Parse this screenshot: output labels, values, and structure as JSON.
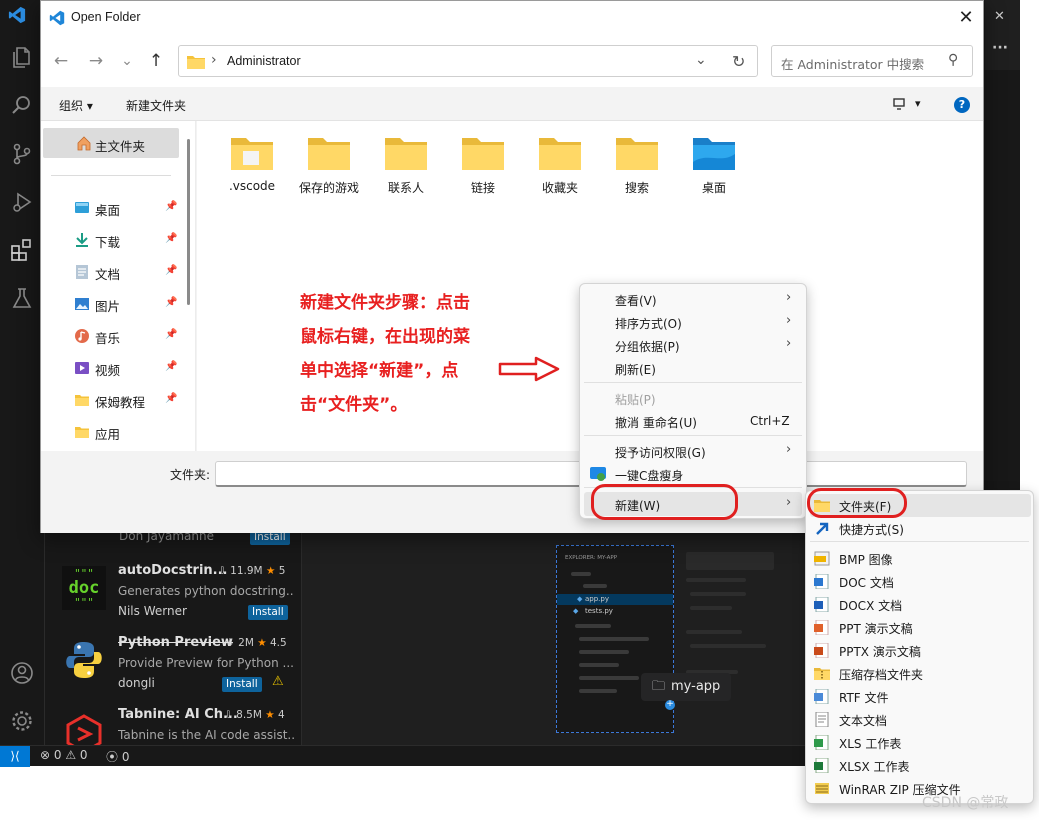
{
  "dialog": {
    "title": "Open Folder",
    "close_glyph": "✕",
    "nav": {
      "back": "←",
      "forward": "→",
      "recent": "⌄",
      "up": "↑"
    },
    "address": {
      "separator": "›",
      "current": "Administrator",
      "dropdown": "⌄",
      "refresh": "↻"
    },
    "search": {
      "placeholder": "在 Administrator 中搜索",
      "icon": "⚲"
    },
    "toolbar": {
      "organize": "组织 ▾",
      "new_folder": "新建文件夹",
      "view_glyph": "▾",
      "help": "?"
    },
    "sidebar": {
      "home": "主文件夹",
      "items": [
        {
          "label": "桌面",
          "icon": "desktop-icon",
          "pinned": true
        },
        {
          "label": "下载",
          "icon": "download-icon",
          "pinned": true
        },
        {
          "label": "文档",
          "icon": "document-icon",
          "pinned": true
        },
        {
          "label": "图片",
          "icon": "pictures-icon",
          "pinned": true
        },
        {
          "label": "音乐",
          "icon": "music-icon",
          "pinned": true
        },
        {
          "label": "视频",
          "icon": "video-icon",
          "pinned": true
        },
        {
          "label": "保姆教程",
          "icon": "folder-icon",
          "pinned": true
        },
        {
          "label": "应用",
          "icon": "folder-icon",
          "pinned": false
        }
      ],
      "pin_glyph": "📌"
    },
    "files": [
      ".vscode",
      "保存的游戏",
      "联系人",
      "链接",
      "收藏夹",
      "搜索",
      "桌面"
    ],
    "folder_field_label": "文件夹:"
  },
  "annotation": {
    "lines": [
      "新建文件夹步骤：点击",
      "鼠标右键，在出现的菜",
      "单中选择“新建”，点",
      "击“文件夹”。"
    ],
    "color": "#e82020"
  },
  "context_menu": {
    "items": [
      {
        "label": "查看(V)",
        "arrow": "›"
      },
      {
        "label": "排序方式(O)",
        "arrow": "›"
      },
      {
        "label": "分组依据(P)",
        "arrow": "›"
      },
      {
        "label": "刷新(E)"
      },
      {
        "label": "粘贴(P)",
        "disabled": true
      },
      {
        "label": "撤消 重命名(U)",
        "shortcut": "Ctrl+Z"
      },
      {
        "label": "授予访问权限(G)",
        "arrow": "›"
      },
      {
        "label": "一键C盘瘦身"
      },
      {
        "label": "新建(W)",
        "arrow": "›"
      }
    ]
  },
  "submenu": {
    "items": [
      {
        "label": "文件夹(F)",
        "icon": "folder-icon"
      },
      {
        "label": "快捷方式(S)",
        "icon": "shortcut-icon"
      },
      {
        "label": "BMP 图像",
        "icon": "bmp-icon"
      },
      {
        "label": "DOC 文档",
        "icon": "doc-icon"
      },
      {
        "label": "DOCX 文档",
        "icon": "docx-icon"
      },
      {
        "label": "PPT 演示文稿",
        "icon": "ppt-icon"
      },
      {
        "label": "PPTX 演示文稿",
        "icon": "pptx-icon"
      },
      {
        "label": "压缩存档文件夹",
        "icon": "zip-folder-icon"
      },
      {
        "label": "RTF 文件",
        "icon": "rtf-icon"
      },
      {
        "label": "文本文档",
        "icon": "txt-icon"
      },
      {
        "label": "XLS 工作表",
        "icon": "xls-icon"
      },
      {
        "label": "XLSX 工作表",
        "icon": "xlsx-icon"
      },
      {
        "label": "WinRAR ZIP 压缩文件",
        "icon": "winrar-icon"
      }
    ]
  },
  "vscode": {
    "extensions": [
      {
        "title": "autoDocstrin...",
        "downloads": "11.9M",
        "rating": "5",
        "desc": "Generates python docstring...",
        "publisher": "Nils Werner",
        "action": "Install"
      },
      {
        "title": "Python Preview",
        "downloads": "2M",
        "rating": "4.5",
        "desc": "Provide Preview for Python ...",
        "publisher": "dongli",
        "action": "Install",
        "warning": "⚠"
      },
      {
        "title": "Tabnine: AI Ch...",
        "downloads": "8.5M",
        "rating": "4",
        "desc": "Tabnine is the AI code assist..."
      }
    ],
    "partial_publisher": "Don Jayamanne",
    "partial_action": "Install",
    "doc_icon_text": {
      "top": "\"\"\"",
      "mid": "doc",
      "bottom": "\"\"\""
    },
    "preview": {
      "header": "EXPLORER: MY-APP",
      "file1": "app.py",
      "file2": "tests.py",
      "tag": "my-app"
    },
    "status": {
      "errors": "0",
      "warnings": "0",
      "remote": "0"
    }
  },
  "watermark": "CSDN @常政"
}
